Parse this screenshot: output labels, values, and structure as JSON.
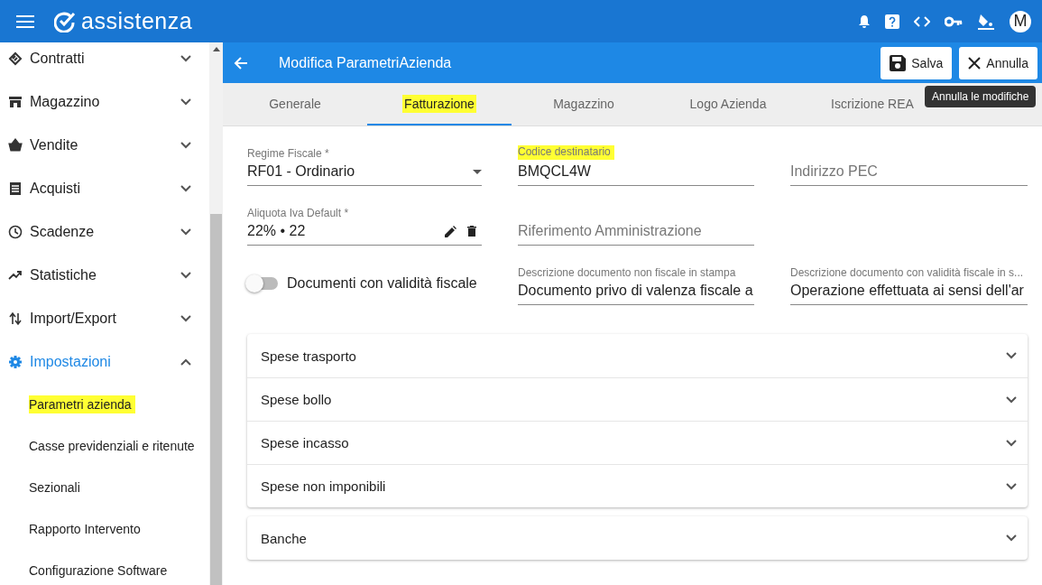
{
  "app": {
    "title": "assistenza",
    "avatar": "M"
  },
  "sidebar": {
    "items": [
      {
        "label": "Contratti",
        "expanded": false,
        "selected": false
      },
      {
        "label": "Magazzino",
        "expanded": false,
        "selected": false
      },
      {
        "label": "Vendite",
        "expanded": false,
        "selected": false
      },
      {
        "label": "Acquisti",
        "expanded": false,
        "selected": false
      },
      {
        "label": "Scadenze",
        "expanded": false,
        "selected": false
      },
      {
        "label": "Statistiche",
        "expanded": false,
        "selected": false
      },
      {
        "label": "Import/Export",
        "expanded": false,
        "selected": false
      },
      {
        "label": "Impostazioni",
        "expanded": true,
        "selected": true,
        "children": [
          {
            "label": "Parametri azienda",
            "highlighted": true
          },
          {
            "label": "Casse previdenziali e ritenute",
            "highlighted": false
          },
          {
            "label": "Sezionali",
            "highlighted": false
          },
          {
            "label": "Rapporto Intervento",
            "highlighted": false
          },
          {
            "label": "Configurazione Software",
            "highlighted": false
          }
        ]
      }
    ]
  },
  "header": {
    "title": "Modifica ParametriAzienda",
    "buttons": [
      {
        "label": "Salva"
      },
      {
        "label": "Annulla"
      }
    ],
    "tooltip": "Annulla le modifiche"
  },
  "tabs": [
    {
      "label": "Generale",
      "selected": false,
      "highlighted": false
    },
    {
      "label": "Fatturazione",
      "selected": true,
      "highlighted": true
    },
    {
      "label": "Magazzino",
      "selected": false,
      "highlighted": false
    },
    {
      "label": "Logo Azienda",
      "selected": false,
      "highlighted": false
    },
    {
      "label": "Iscrizione REA",
      "selected": false,
      "highlighted": false
    }
  ],
  "form": {
    "rows": [
      [
        {
          "kind": "select",
          "label": "Regime Fiscale *",
          "value": "RF01 - Ordinario",
          "highlighted": false
        },
        {
          "kind": "text",
          "label": "Codice destinatario",
          "value": "BMQCL4W",
          "highlighted": true
        },
        {
          "kind": "text",
          "placeholder": "Indirizzo PEC"
        }
      ],
      [
        {
          "kind": "iva",
          "label": "Aliquota Iva Default *",
          "value": "22% • 22",
          "highlighted": false
        },
        {
          "kind": "text",
          "placeholder": "Riferimento Amministrazione"
        }
      ],
      [
        {
          "kind": "toggle",
          "label": "Documenti con validità fiscale",
          "on": false
        },
        {
          "kind": "text",
          "label": "Descrizione documento non fiscale in stampa",
          "value": "Documento privo di valenza fiscale a",
          "highlighted": false
        },
        {
          "kind": "text",
          "label": "Descrizione documento con validità fiscale in s...",
          "value": "Operazione effettuata ai sensi dell'ar",
          "highlighted": false
        }
      ]
    ]
  },
  "panels": [
    {
      "items": [
        {
          "title": "Spese trasporto",
          "expanded": false
        },
        {
          "title": "Spese bollo",
          "expanded": false
        },
        {
          "title": "Spese incasso",
          "expanded": false
        },
        {
          "title": "Spese non imponibili",
          "expanded": false
        }
      ]
    },
    {
      "items": [
        {
          "title": "Banche",
          "expanded": false
        }
      ]
    }
  ]
}
